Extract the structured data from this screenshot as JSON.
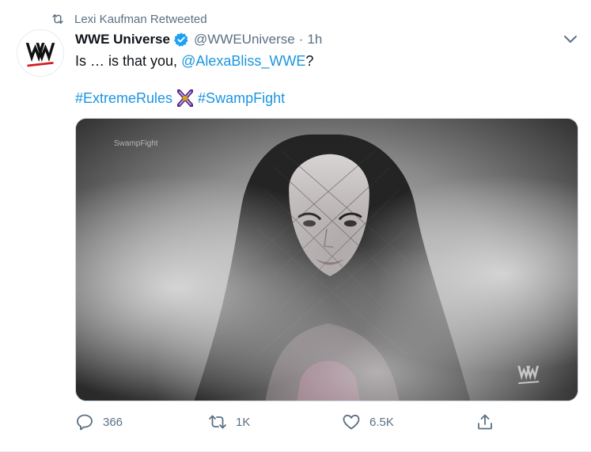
{
  "retweet_context": {
    "icon": "retweet-icon",
    "text": "Lexi Kaufman Retweeted"
  },
  "author": {
    "avatar": "wwe-logo",
    "display_name": "WWE Universe",
    "verified_icon": "verified-badge-icon",
    "handle": "@WWEUniverse",
    "separator": "·",
    "time": "1h"
  },
  "tweet": {
    "text_prefix": "Is … is that you, ",
    "mention": "@AlexaBliss_WWE",
    "text_suffix": "?",
    "hashtag_1": "#ExtremeRules",
    "hashtag_emoji_icon": "extreme-rules-emoji-icon",
    "hashtag_2": "#SwampFight"
  },
  "media": {
    "overlay_text": "SwampFight",
    "watermark": "wwe-watermark"
  },
  "actions": {
    "reply_count": "366",
    "retweet_count": "1K",
    "like_count": "6.5K"
  },
  "colors": {
    "link": "#1b95e0",
    "secondary_text": "#5b7083",
    "verified": "#1da1f2",
    "wwe_red": "#d71920"
  }
}
